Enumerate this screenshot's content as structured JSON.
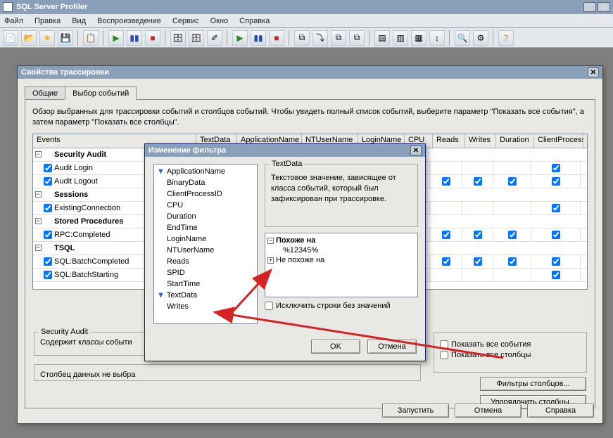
{
  "app": {
    "title": "SQL Server Profiler"
  },
  "menus": {
    "file": "Файл",
    "edit": "Правка",
    "view": "Вид",
    "replay": "Воспроизведение",
    "tools": "Сервис",
    "window": "Окно",
    "help": "Справка"
  },
  "traceDlg": {
    "title": "Свойства трассировки",
    "tabs": {
      "general": "Общие",
      "events": "Выбор событий"
    },
    "overview": "Обзор выбранных для трассировки событий и столбцов событий. Чтобы увидеть полный список событий, выберите параметр \"Показать все события\", а затем параметр \"Показать все столбцы\".",
    "grid": {
      "eventsHdr": "Events",
      "cols": [
        "TextData",
        "ApplicationName",
        "NTUserName",
        "LoginName",
        "CPU",
        "Reads",
        "Writes",
        "Duration",
        "ClientProcess"
      ]
    },
    "rows": [
      {
        "type": "cat",
        "label": "Security Audit"
      },
      {
        "type": "item",
        "label": "Audit Login",
        "checks": [
          true,
          true,
          true,
          true,
          null,
          null,
          null,
          null,
          true
        ]
      },
      {
        "type": "item",
        "label": "Audit Logout",
        "checks": [
          null,
          true,
          true,
          true,
          true,
          true,
          true,
          true,
          true
        ]
      },
      {
        "type": "cat",
        "label": "Sessions"
      },
      {
        "type": "item",
        "label": "ExistingConnection",
        "checks": [
          true,
          true,
          true,
          true,
          null,
          null,
          null,
          null,
          true
        ]
      },
      {
        "type": "cat",
        "label": "Stored Procedures"
      },
      {
        "type": "item",
        "label": "RPC:Completed",
        "checks": [
          null,
          true,
          true,
          true,
          true,
          true,
          true,
          true,
          true
        ]
      },
      {
        "type": "cat",
        "label": "TSQL"
      },
      {
        "type": "item",
        "label": "SQL:BatchCompleted",
        "checks": [
          true,
          true,
          true,
          true,
          true,
          true,
          true,
          true,
          true
        ]
      },
      {
        "type": "item",
        "label": "SQL:BatchStarting",
        "checks": [
          true,
          true,
          true,
          true,
          null,
          null,
          null,
          null,
          true
        ]
      }
    ],
    "secAudit": {
      "title": "Security Audit",
      "text": "Содержит классы событи"
    },
    "colData": "Столбец данных не выбра",
    "showAllEvents": "Показать все события",
    "showAllCols": "Показать все столбцы",
    "colFilters": "Фильтры столбцов...",
    "orderCols": "Упорядочить столбцы...",
    "run": "Запустить",
    "cancel": "Отмена",
    "help": "Справка"
  },
  "filterDlg": {
    "title": "Изменение фильтра",
    "columns": [
      "ApplicationName",
      "BinaryData",
      "ClientProcessID",
      "CPU",
      "Duration",
      "EndTime",
      "LoginName",
      "NTUserName",
      "Reads",
      "SPID",
      "StartTime",
      "TextData",
      "Writes"
    ],
    "filteredCols": [
      "ApplicationName",
      "TextData"
    ],
    "desc": {
      "title": "TextData",
      "text": "Текстовое значение, зависящее от класса событий, который был зафиксирован при трассировке."
    },
    "tree": {
      "like": "Похоже на",
      "value": "%12345%",
      "notLike": "Не похоже на"
    },
    "exclude": "Исключить строки без значений",
    "ok": "OK",
    "cancel": "Отмена"
  }
}
